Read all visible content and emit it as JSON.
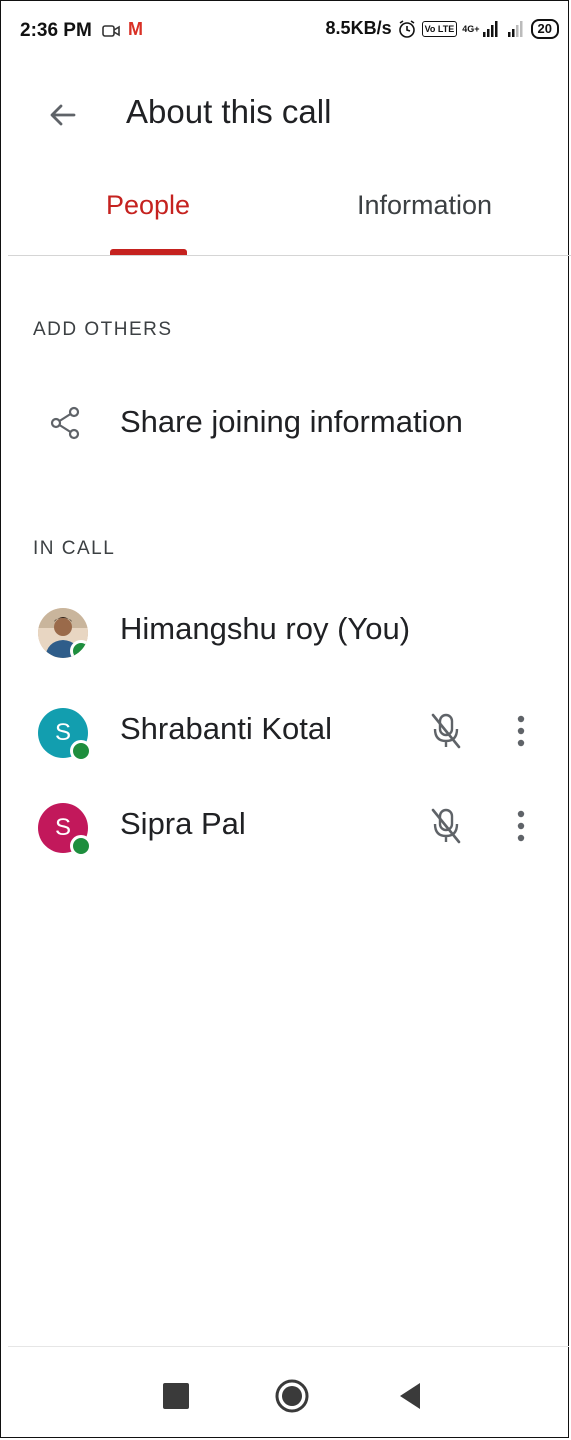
{
  "status_bar": {
    "time": "2:36 PM",
    "gmail": "M",
    "speed": "8.5KB/s",
    "volte": "Vo LTE",
    "network_label": "4G+",
    "battery": "20"
  },
  "header": {
    "title": "About this call"
  },
  "tabs": [
    {
      "label": "People",
      "active": true
    },
    {
      "label": "Information",
      "active": false
    }
  ],
  "add_others": {
    "heading": "ADD OTHERS",
    "share_label": "Share joining information"
  },
  "in_call": {
    "heading": "IN CALL",
    "people": [
      {
        "name": "Himangshu roy (You)",
        "initial": "",
        "avatar_color": "#d9b99b",
        "muted": false
      },
      {
        "name": "Shrabanti Kotal",
        "initial": "S",
        "avatar_color": "#129eaf",
        "muted": true
      },
      {
        "name": "Sipra Pal",
        "initial": "S",
        "avatar_color": "#c2185b",
        "muted": true
      }
    ]
  },
  "colors": {
    "accent": "#c5221f",
    "online": "#1e8e3e"
  },
  "icons": {
    "back": "arrow-back-icon",
    "share": "share-icon",
    "mic_off": "mic-off-icon",
    "more": "more-vert-icon"
  }
}
